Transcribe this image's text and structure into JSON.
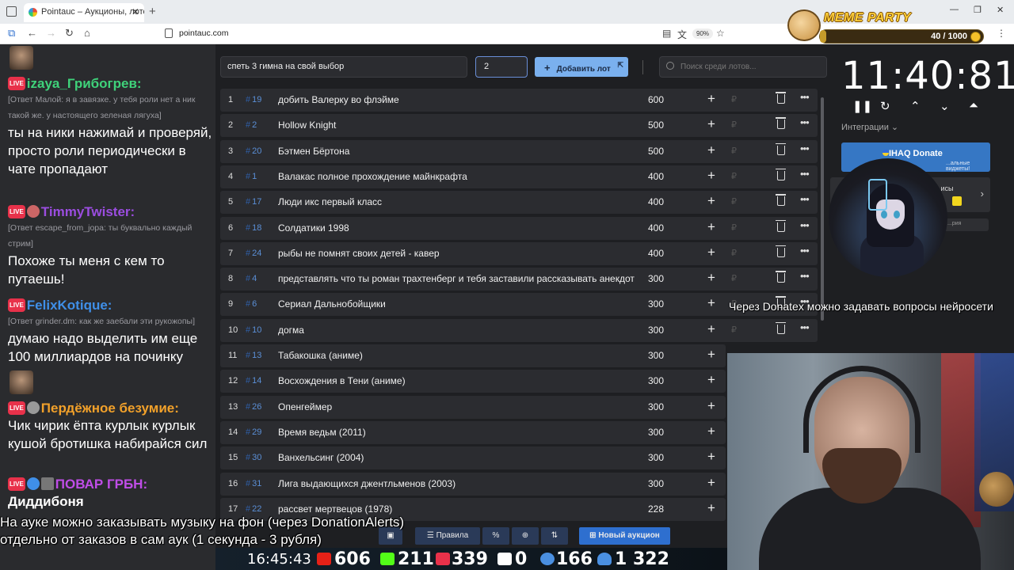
{
  "browser": {
    "tab_title": "Pointauc – Аукционы, лотереи",
    "url": "pointauc.com",
    "zoom": "90%"
  },
  "meme_party": {
    "title": "MEME PARTY",
    "progress_label": "40 / 1000",
    "progress": 0.04
  },
  "chat": [
    {
      "user": "izaya_Грибогрев:",
      "user_color": "#3fd27a",
      "reply": "[Ответ Малой: я в завязке. у тебя роли нет а ник такой же. у настоящего зеленая лягуха]",
      "text": "ты на ники нажимай и проверяй, просто роли периодически в чате пропадают"
    },
    {
      "user": "TimmyTwister:",
      "user_color": "#9b4de0",
      "reply": "[Ответ escape_from_jopa: ты буквально каждый стрим]",
      "text": "Похоже ты меня с кем то путаешь!"
    },
    {
      "user": "FelixKotique:",
      "user_color": "#3f8fe8",
      "reply": "[Ответ grinder.dm: как же заебали эти рукожопы]",
      "text": "думаю надо выделить им еще 100 миллиардов на починку"
    },
    {
      "user": "Пердёжное безумие:",
      "user_color": "#f2a12a",
      "reply": "",
      "text": "Чик чирик ёпта курлык курлык кушой бротишка набирайся сил"
    },
    {
      "user": "ПОВАР ГРБН:",
      "user_color": "#c04de8",
      "reply": "",
      "text": "Диддибоня"
    }
  ],
  "form": {
    "lot_name_value": "спеть 3 гимна на свой выбор",
    "amount_value": "2",
    "add_label": "Добавить лот",
    "search_placeholder": "Поиск среди лотов..."
  },
  "lots": [
    {
      "n": "1",
      "id": "19",
      "name": "добить Валерку во флэйме",
      "amount": "600"
    },
    {
      "n": "2",
      "id": "2",
      "name": "Hollow Knight",
      "amount": "500"
    },
    {
      "n": "3",
      "id": "20",
      "name": "Бэтмен Бёртона",
      "amount": "500"
    },
    {
      "n": "4",
      "id": "1",
      "name": "Валакас полное прохождение майнкрафта",
      "amount": "400"
    },
    {
      "n": "5",
      "id": "17",
      "name": "Люди икс первый класс",
      "amount": "400"
    },
    {
      "n": "6",
      "id": "18",
      "name": "Солдатики 1998",
      "amount": "400"
    },
    {
      "n": "7",
      "id": "24",
      "name": "рыбы не помнят своих детей - кавер",
      "amount": "400"
    },
    {
      "n": "8",
      "id": "4",
      "name": "представлять что ты роман трахтенберг и тебя заставили рассказывать анекдоты",
      "amount": "300"
    },
    {
      "n": "9",
      "id": "6",
      "name": "Сериал Дальнобойщики",
      "amount": "300"
    },
    {
      "n": "10",
      "id": "10",
      "name": "догма",
      "amount": "300"
    },
    {
      "n": "11",
      "id": "13",
      "name": "Табакошка (аниме)",
      "amount": "300"
    },
    {
      "n": "12",
      "id": "14",
      "name": "Восхождения в Тени (аниме)",
      "amount": "300"
    },
    {
      "n": "13",
      "id": "26",
      "name": "Опенгеймер",
      "amount": "300"
    },
    {
      "n": "14",
      "id": "29",
      "name": "Время ведьм (2011)",
      "amount": "300"
    },
    {
      "n": "15",
      "id": "30",
      "name": "Ванхельсинг (2004)",
      "amount": "300"
    },
    {
      "n": "16",
      "id": "31",
      "name": "Лига выдающихся джентльменов (2003)",
      "amount": "300"
    },
    {
      "n": "17",
      "id": "22",
      "name": "рассвет мертвецов (1978)",
      "amount": "228"
    }
  ],
  "lot_symbols": {
    "hash": "#",
    "plus": "+",
    "rub": "₽",
    "more": "•••"
  },
  "toolbar": {
    "rules_label": "Правила",
    "percent_label": "%",
    "new_auction_label": "Новый аукцион"
  },
  "timer": {
    "value": "11:40:81"
  },
  "integrations": {
    "label": "Интеграции",
    "donate_title": "IHAQ Donate",
    "donate_sub": "...альные виджеты!",
    "services_label": "...исы",
    "history_label": "...рия"
  },
  "overlays": {
    "donatex": "Через Donatex можно задавать вопросы нейросети",
    "music_line1": "На ауке можно заказывать музыку на фон (через DonationAlerts)",
    "music_line2": "отдельно от заказов в сам аук (1 секунда - 3 рубля)"
  },
  "stats": {
    "time": "16:45:43",
    "youtube": "606",
    "kick": "211",
    "vkplay": "339",
    "rutube": "0",
    "vk": "166",
    "total": "1 322"
  },
  "colors": {
    "accent": "#7ab0ee",
    "primary_button": "#2e6fcf",
    "lot_bg": "#2b2c30",
    "id_color": "#5b8fd6"
  }
}
